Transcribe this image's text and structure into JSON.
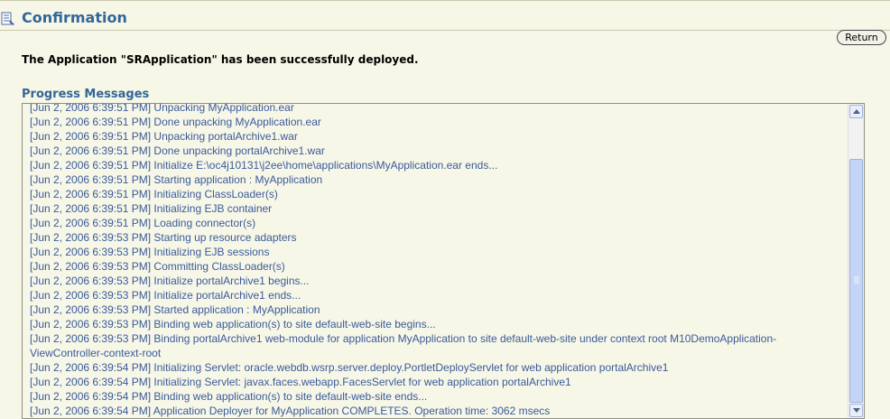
{
  "header": {
    "title": "Confirmation",
    "icon": "document-list-icon"
  },
  "actions": {
    "return_label": "Return"
  },
  "confirmation": {
    "message": "The Application \"SRApplication\" has been successfully deployed."
  },
  "progress": {
    "title": "Progress Messages",
    "lines": [
      "[Jun 2, 2006 6:39:51 PM] Unpacking MyApplication.ear",
      "[Jun 2, 2006 6:39:51 PM] Done unpacking MyApplication.ear",
      "[Jun 2, 2006 6:39:51 PM] Unpacking portalArchive1.war",
      "[Jun 2, 2006 6:39:51 PM] Done unpacking portalArchive1.war",
      "[Jun 2, 2006 6:39:51 PM] Initialize E:\\oc4j10131\\j2ee\\home\\applications\\MyApplication.ear ends...",
      "[Jun 2, 2006 6:39:51 PM] Starting application : MyApplication",
      "[Jun 2, 2006 6:39:51 PM] Initializing ClassLoader(s)",
      "[Jun 2, 2006 6:39:51 PM] Initializing EJB container",
      "[Jun 2, 2006 6:39:51 PM] Loading connector(s)",
      "[Jun 2, 2006 6:39:53 PM] Starting up resource adapters",
      "[Jun 2, 2006 6:39:53 PM] Initializing EJB sessions",
      "[Jun 2, 2006 6:39:53 PM] Committing ClassLoader(s)",
      "[Jun 2, 2006 6:39:53 PM] Initialize portalArchive1 begins...",
      "[Jun 2, 2006 6:39:53 PM] Initialize portalArchive1 ends...",
      "[Jun 2, 2006 6:39:53 PM] Started application : MyApplication",
      "[Jun 2, 2006 6:39:53 PM] Binding web application(s) to site default-web-site begins...",
      "[Jun 2, 2006 6:39:53 PM] Binding portalArchive1 web-module for application MyApplication to site default-web-site under context root M10DemoApplication-ViewController-context-root",
      "[Jun 2, 2006 6:39:54 PM] Initializing Servlet: oracle.webdb.wsrp.server.deploy.PortletDeployServlet for web application portalArchive1",
      "[Jun 2, 2006 6:39:54 PM] Initializing Servlet: javax.faces.webapp.FacesServlet for web application portalArchive1",
      "[Jun 2, 2006 6:39:54 PM] Binding web application(s) to site default-web-site ends...",
      "[Jun 2, 2006 6:39:54 PM] Application Deployer for MyApplication COMPLETES. Operation time: 3062 msecs"
    ]
  },
  "icons": {
    "scroll_up": "arrow-up-icon",
    "scroll_down": "arrow-down-icon"
  },
  "colors": {
    "accent": "#336699",
    "log_text": "#3a5a9a",
    "background": "#f7f7e7"
  }
}
